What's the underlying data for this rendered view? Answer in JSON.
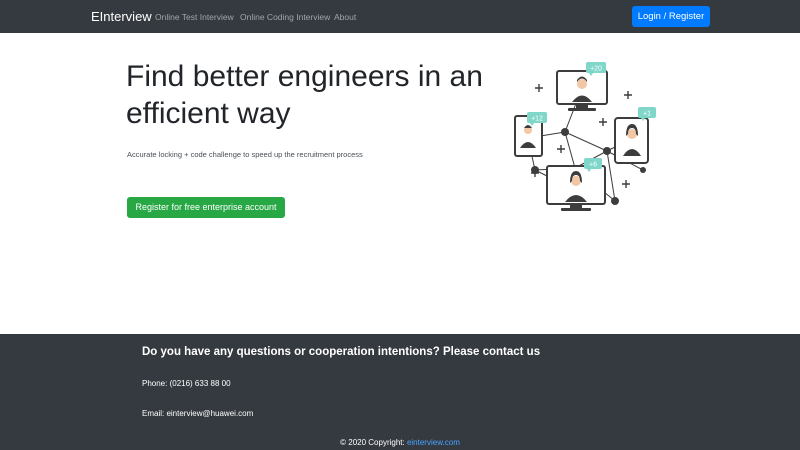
{
  "navbar": {
    "brand": "EInterview",
    "links": [
      "Online Test Interview",
      "Online Coding Interview",
      "About"
    ],
    "login_label": "Login / Register"
  },
  "hero": {
    "title": "Find better engineers in an efficient way",
    "subtitle": "Accurate locking + code challenge to speed up the recruitment process",
    "cta_label": "Register for free enterprise account",
    "badges": [
      "+20",
      "+12",
      "+1",
      "+6"
    ]
  },
  "footer": {
    "title": "Do you have any questions or cooperation intentions? Please contact us",
    "phone": "Phone: (0216) 633 88 00",
    "email": "Email: einterview@huawei.com",
    "copyright_prefix": "© 2020 Copyright: ",
    "copyright_link": "einterview.com"
  },
  "colors": {
    "navbar_bg": "#343a40",
    "primary": "#007bff",
    "success": "#28a745",
    "badge": "#7fd6c9",
    "link": "#4aa3ff"
  },
  "icons": {
    "network": "network-illustration",
    "person": "person-avatar-icon",
    "plus": "plus-icon"
  }
}
